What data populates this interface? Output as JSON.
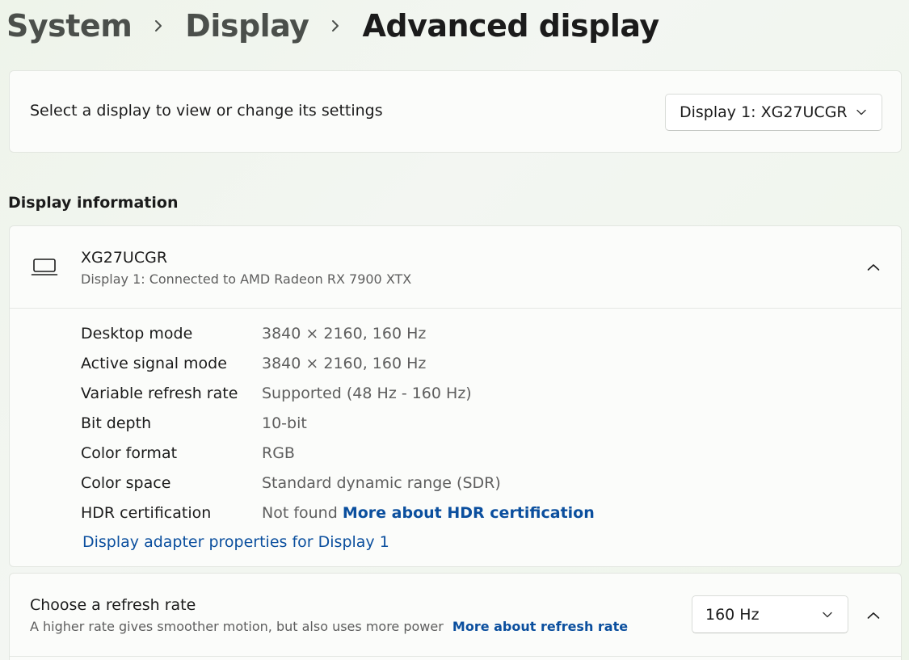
{
  "breadcrumb": {
    "items": [
      "System",
      "Display",
      "Advanced display"
    ]
  },
  "select_display": {
    "label": "Select a display to view or change its settings",
    "selected": "Display 1: XG27UCGR"
  },
  "display_information": {
    "heading": "Display information",
    "monitor_name": "XG27UCGR",
    "connection": "Display 1: Connected to AMD Radeon RX 7900 XTX",
    "rows": [
      {
        "label": "Desktop mode",
        "value": "3840 × 2160, 160 Hz"
      },
      {
        "label": "Active signal mode",
        "value": "3840 × 2160, 160 Hz"
      },
      {
        "label": "Variable refresh rate",
        "value": "Supported (48 Hz - 160 Hz)"
      },
      {
        "label": "Bit depth",
        "value": "10-bit"
      },
      {
        "label": "Color format",
        "value": "RGB"
      },
      {
        "label": "Color space",
        "value": "Standard dynamic range (SDR)"
      },
      {
        "label": "HDR certification",
        "value": "Not found",
        "link": "More about HDR certification"
      }
    ],
    "adapter_link": "Display adapter properties for Display 1"
  },
  "refresh_rate": {
    "title": "Choose a refresh rate",
    "description": "A higher rate gives smoother motion, but also uses more power",
    "link": "More about refresh rate",
    "selected": "160 Hz"
  },
  "icons": {
    "breadcrumb_separator": "chevron-right-icon",
    "dropdown": "chevron-down-icon",
    "collapse": "chevron-up-icon",
    "monitor": "laptop-icon"
  },
  "colors": {
    "link": "#0b4f9e",
    "card_background": "#fbfcfa",
    "secondary_text": "#5e5e5e"
  }
}
